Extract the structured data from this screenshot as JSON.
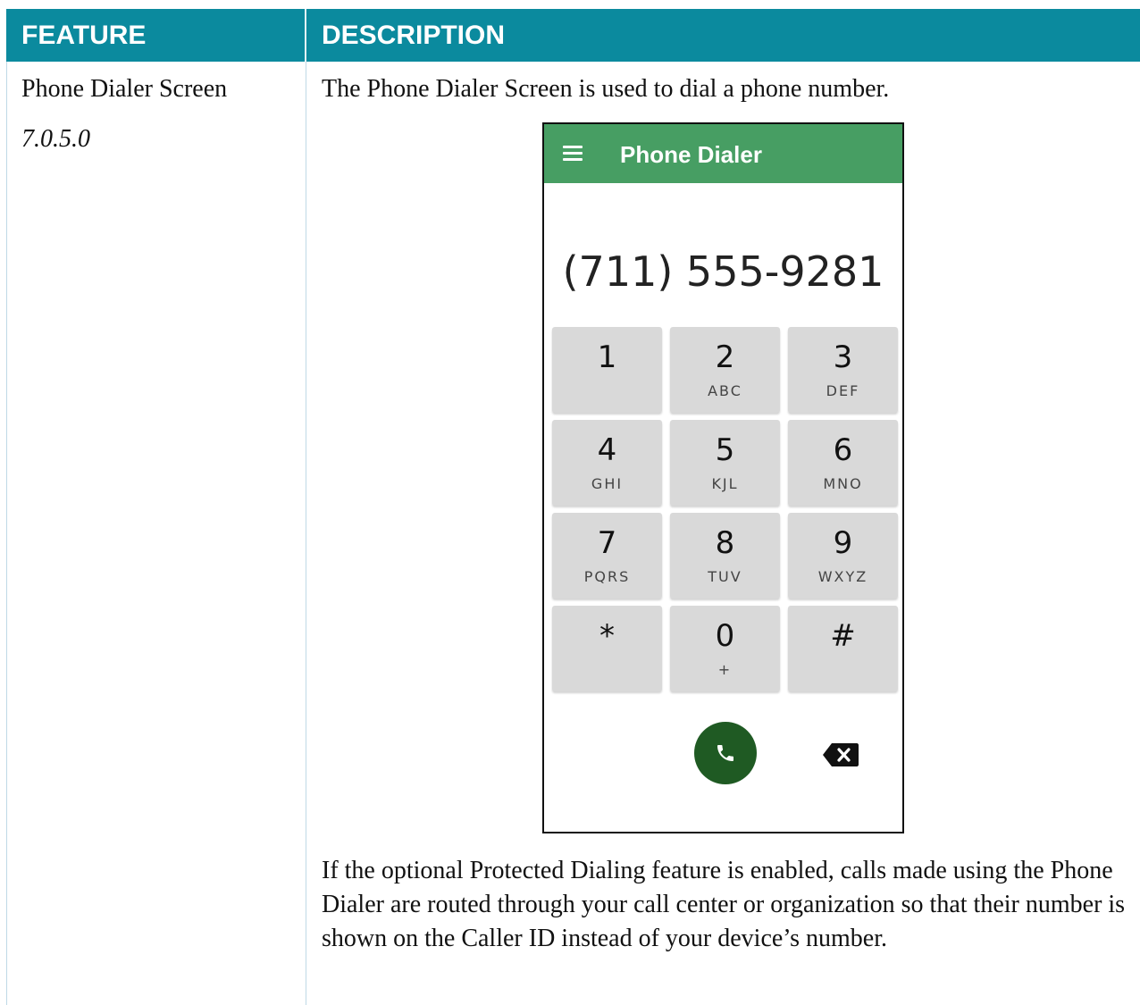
{
  "table": {
    "headers": {
      "feature": "FEATURE",
      "description": "DESCRIPTION"
    },
    "row": {
      "feature_name": "Phone Dialer Screen",
      "feature_version": "7.0.5.0",
      "description_intro": "The Phone Dialer Screen is used to dial a phone number.",
      "description_note": "If the optional Protected Dialing feature is enabled, calls made using the Phone Dialer are routed through your call center or organization so that their number is shown on the Caller ID instead of your device’s number."
    }
  },
  "phone": {
    "appbar_title": "Phone Dialer",
    "menu_icon": "hamburger-menu-icon",
    "number": "(711) 555-9281",
    "keys": [
      {
        "digit": "1",
        "letters": ""
      },
      {
        "digit": "2",
        "letters": "ABC"
      },
      {
        "digit": "3",
        "letters": "DEF"
      },
      {
        "digit": "4",
        "letters": "GHI"
      },
      {
        "digit": "5",
        "letters": "KJL"
      },
      {
        "digit": "6",
        "letters": "MNO"
      },
      {
        "digit": "7",
        "letters": "PQRS"
      },
      {
        "digit": "8",
        "letters": "TUV"
      },
      {
        "digit": "9",
        "letters": "WXYZ"
      },
      {
        "digit": "*",
        "letters": ""
      },
      {
        "digit": "0",
        "letters": "+"
      },
      {
        "digit": "#",
        "letters": ""
      }
    ],
    "call_icon": "phone-handset-icon",
    "backspace_icon": "backspace-icon"
  },
  "colors": {
    "header_bg": "#0b8a9e",
    "appbar_bg": "#479e63",
    "call_button_bg": "#1f5a23",
    "key_bg": "#d9d9d9"
  }
}
